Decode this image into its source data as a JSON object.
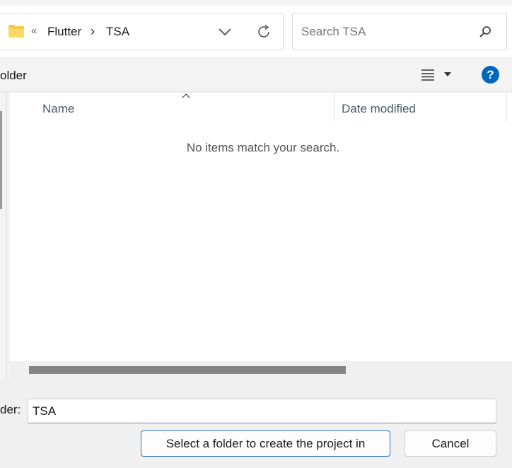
{
  "address": {
    "overflow_chevron": "«",
    "crumbs": [
      "Flutter",
      "TSA"
    ],
    "separator": "›"
  },
  "search": {
    "placeholder": "Search TSA"
  },
  "command_bar": {
    "new_folder_label_partial": "older",
    "help_label": "?"
  },
  "columns": {
    "name": "Name",
    "date_modified": "Date modified"
  },
  "empty_message": "No items match your search.",
  "folder_field": {
    "label_partial": "der:",
    "value": "TSA"
  },
  "buttons": {
    "select": "Select a folder to create the project in",
    "cancel": "Cancel"
  },
  "colors": {
    "accent": "#0067c0",
    "folder": "#f6c94e"
  }
}
